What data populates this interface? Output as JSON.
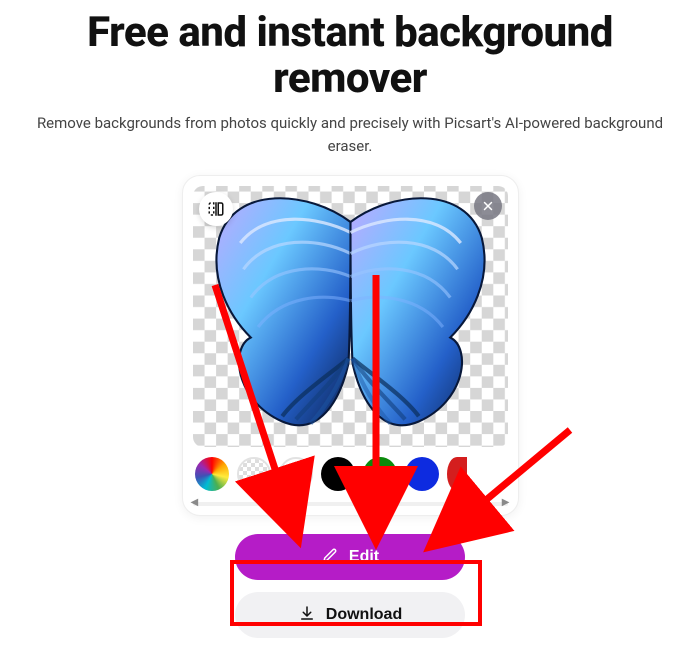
{
  "header": {
    "title": "Free and instant background remover",
    "subtitle": "Remove backgrounds from photos quickly and precisely with Picsart's AI-powered background eraser."
  },
  "editor": {
    "compare_icon": "compare-icon",
    "close_icon": "close-icon",
    "swatches": [
      {
        "name": "rainbow",
        "label": "Color picker"
      },
      {
        "name": "transparent",
        "label": "Transparent"
      },
      {
        "name": "white",
        "label": "White"
      },
      {
        "name": "black",
        "label": "Black"
      },
      {
        "name": "green",
        "label": "Green"
      },
      {
        "name": "blue",
        "label": "Blue"
      },
      {
        "name": "red",
        "label": "Red"
      }
    ]
  },
  "buttons": {
    "edit": "Edit",
    "download": "Download"
  },
  "annotation": {
    "highlight_target": "download-button"
  }
}
